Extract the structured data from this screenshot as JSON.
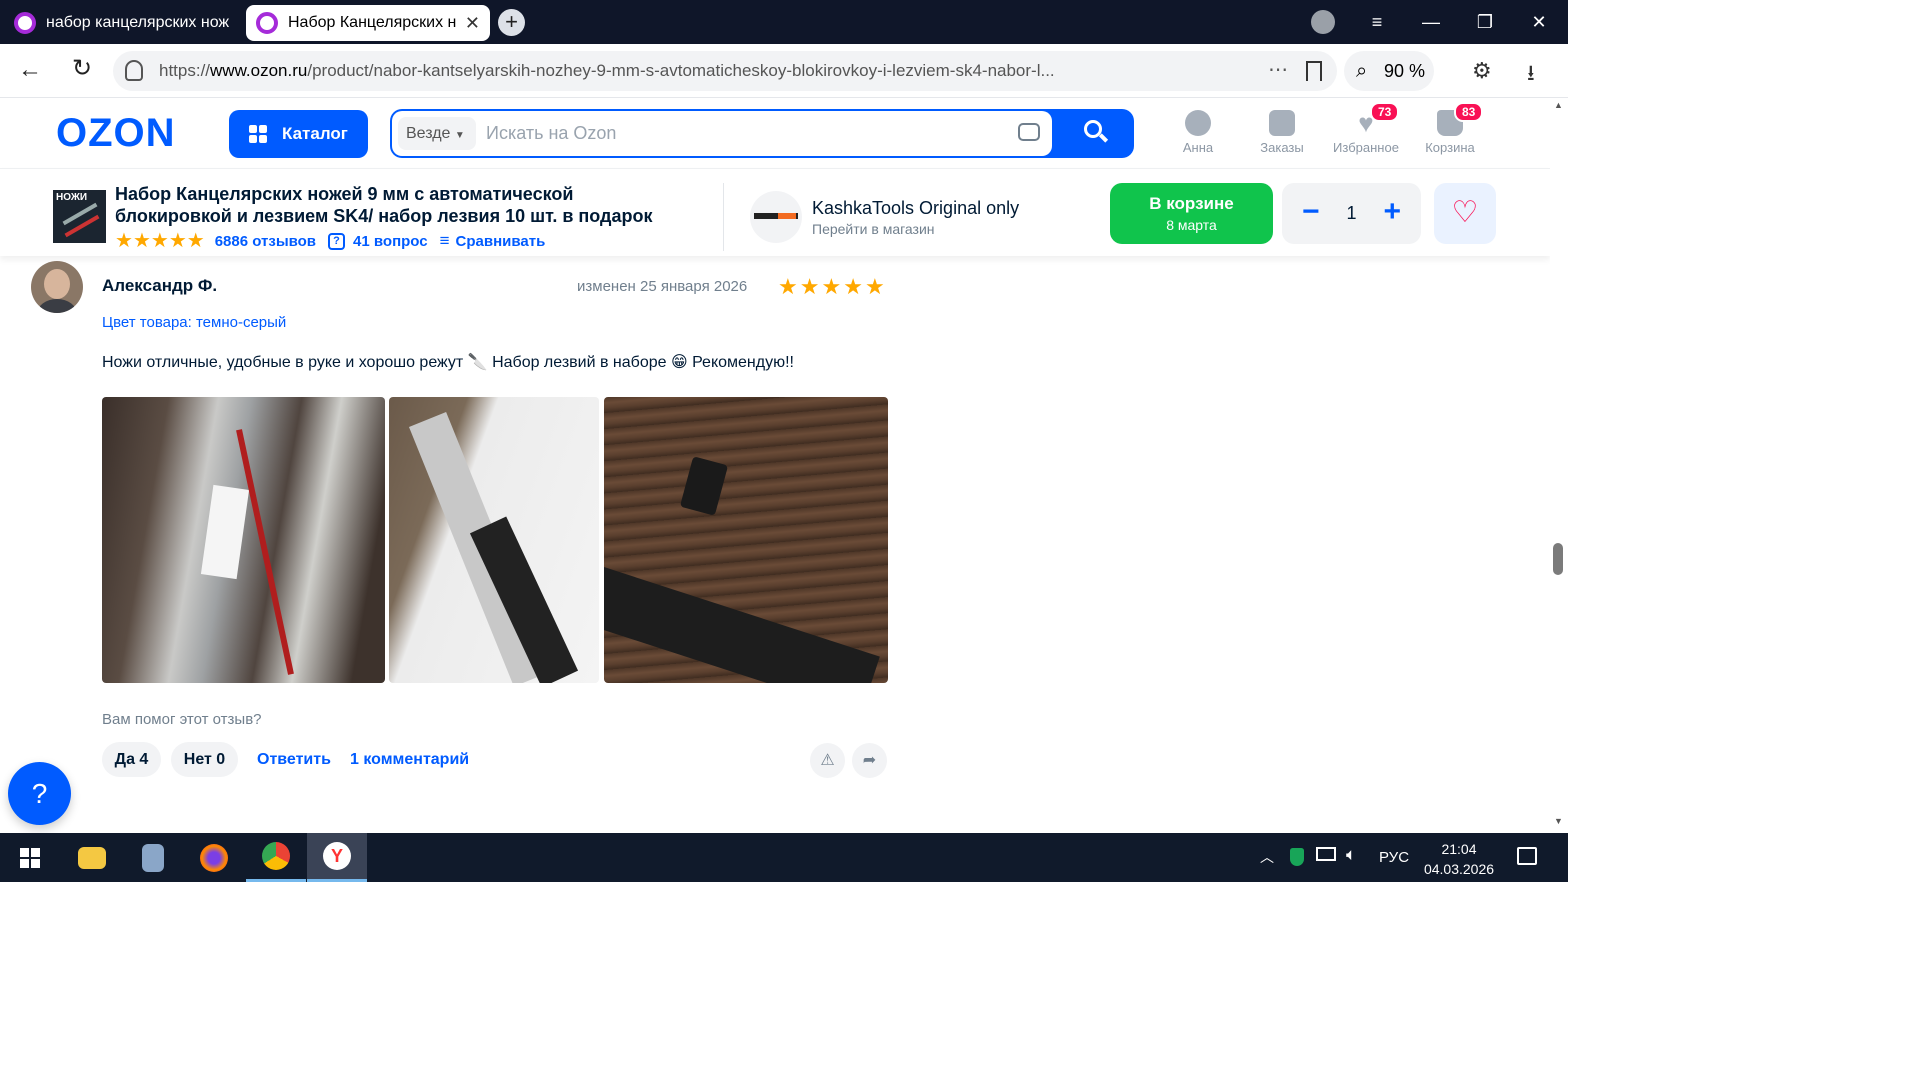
{
  "browser": {
    "tabs": [
      {
        "label": "набор канцелярских нож",
        "active": false
      },
      {
        "label": "Набор Канцелярских н",
        "active": true
      }
    ],
    "url_prefix": "https://",
    "url_domain": "www.ozon.ru",
    "url_path": "/product/nabor-kantselyarskih-nozhey-9-mm-s-avtomaticheskoy-blokirovkoy-i-lezviem-sk4-nabor-l...",
    "zoom": "90 %"
  },
  "header": {
    "logo": "OZON",
    "catalog_label": "Каталог",
    "search_scope": "Везде",
    "search_placeholder": "Искать на Ozon",
    "nav": [
      {
        "label": "Анна",
        "icon": "user-icon"
      },
      {
        "label": "Заказы",
        "icon": "box-icon"
      },
      {
        "label": "Избранное",
        "icon": "heart-icon",
        "badge": "73"
      },
      {
        "label": "Корзина",
        "icon": "cart-icon",
        "badge": "83"
      }
    ]
  },
  "product_bar": {
    "thumb_text": "НОЖИ",
    "title": "Набор Канцелярских ножей 9 мм с автоматической блокировкой и лезвием SK4/ набор лезвия 10 шт. в подарок",
    "rating_stars": 5,
    "reviews": "6886 отзывов",
    "questions": "41 вопрос",
    "compare": "Сравнивать",
    "shop_name": "KashkaTools Original only",
    "shop_link": "Перейти в магазин",
    "cart_button_line1": "В корзине",
    "cart_button_line2": "8 марта",
    "quantity": "1"
  },
  "review": {
    "author": "Александр Ф.",
    "date": "изменен 25 января 2026",
    "stars": 5,
    "color_label": "Цвет товара: темно-серый",
    "text": "Ножи отличные, удобные в руке и хорошо режут 🔪 Набор лезвий в наборе 😁 Рекомендую!!",
    "helpful_question": "Вам помог этот отзыв?",
    "yes_label": "Да 4",
    "no_label": "Нет 0",
    "reply_label": "Ответить",
    "comments_label": "1 комментарий"
  },
  "taskbar": {
    "language": "РУС",
    "time": "21:04",
    "date": "04.03.2026"
  },
  "colors": {
    "ozon_blue": "#005bff",
    "cart_green": "#10c44c",
    "badge_pink": "#f91155",
    "star_orange": "#ffa800"
  }
}
